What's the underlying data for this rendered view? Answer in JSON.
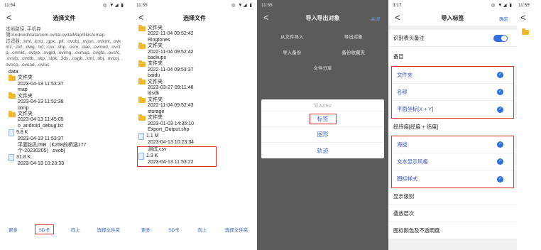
{
  "p1": {
    "time": "11:54",
    "signal": "◎ ▼◢ ▮",
    "title": "选择文件",
    "back": "<",
    "path": "本地路径: 手机存储/Android/data/com.ovital.ovitalMap/files/omap",
    "filter": "过滤器: .kml, .kmz, .gpx, .plt, .ovobj, .ovjsn, .ovkml, .ovkmz, .dxf, .dwg, .txt, .csv, .shp, .osm, .dae, .ovmod, .ovctp, .ovmkt, .ovtyp, .ovgld, .ovimg, .ovmap, .ovgfa, .ovsfc, .ovsfp, .ovdtb, .skp, .slpk, .3ds, .osgb, .xml, .obj, .ovcoj, .ovocp, .ovcad, .ovluc",
    "items": [
      {
        "name": "data",
        "type": "文件夹",
        "date": "2023-04-13 11:53:37"
      },
      {
        "name": "map",
        "type": "文件夹",
        "date": "2023-04-13 11:52:38"
      },
      {
        "name": "otmp",
        "type": "文件夹",
        "date": "2023-04-13 11:45:05"
      },
      {
        "name": "o_android_debug.txt",
        "size": "9.8 K",
        "date": "2023-04-13 11:53:37"
      },
      {
        "name": "平面钻孔05B（K268前桥涵177个-20230205）.ovobj",
        "size": "31.8 K",
        "date": "2023-04-13 10:23:33"
      }
    ],
    "bottom": [
      "更多",
      "SD卡",
      "向上",
      "选择文件夹"
    ]
  },
  "p2": {
    "time": "11:55",
    "signal": "◎ ▼◢ ▮",
    "title": "选择文件",
    "back": "<",
    "items": [
      {
        "type": "文件夹",
        "date": "2022-11-04 09:52:42",
        "name": "Ringtones"
      },
      {
        "type": "文件夹",
        "date": "2022-11-04 09:52:42",
        "name": "backups"
      },
      {
        "type": "文件夹",
        "date": "2022-11-04 09:53:37",
        "name": "baidu"
      },
      {
        "type": "文件夹",
        "date": "2023-03-27 09:11:48",
        "name": "ldsdk"
      },
      {
        "type": "文件夹",
        "date": "2022-11-04 09:52:43",
        "name": "storage"
      },
      {
        "type": "文件夹",
        "date": "2023-01-03 14:35:10",
        "name": "Export_Output.shp"
      }
    ],
    "shp": {
      "size": "1.1 M",
      "date": "2023-04-13 10:23:34"
    },
    "csv": {
      "name": "测试.csv",
      "size": "1.3 K",
      "date": "2023-04-13 11:53:22"
    },
    "bottom": [
      "更多",
      "SD卡",
      "向上",
      "选择文件夹"
    ]
  },
  "p3": {
    "time": "11:55",
    "title": "导入导出对象",
    "act": "关闭",
    "back": "<",
    "grid": [
      "从文件导入",
      "导出对象",
      "导入备份",
      "备份收藏夹",
      "文件分享"
    ],
    "sheet_title": "导入CSV",
    "options": [
      "标签",
      "图形",
      "轨迹"
    ]
  },
  "p4": {
    "time": "3:17",
    "signal": "◎ ▼◢ ▮",
    "title": "导入标签",
    "act": "确定",
    "back": "<",
    "toggle_label": "识别表头备注",
    "group": "备目",
    "g1": [
      "文件夹",
      "名称",
      "平面坐标[X + Y]"
    ],
    "mid": "经纬度[经度 + 纬度]",
    "g2": [
      "海拔",
      "文本显示风格",
      "图标样式"
    ],
    "rest": [
      "显示级别",
      "叠放层次",
      "图标颜色及不透明度"
    ]
  },
  "p5": {
    "time": "11:55",
    "back": "<"
  }
}
